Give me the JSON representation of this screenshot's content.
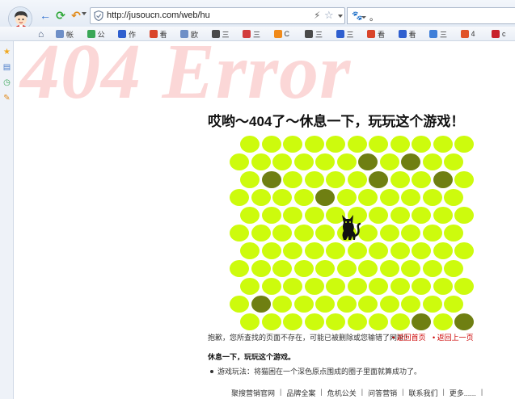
{
  "browser": {
    "url": "http://jusoucn.com/web/hu",
    "search_text": "。",
    "favorites": [
      {
        "label": "帐",
        "icon": "page-icon",
        "color": "#6e8fc7"
      },
      {
        "label": "公",
        "icon": "chrome-icon",
        "color": "#3aa757"
      },
      {
        "label": "作",
        "icon": "baidu-paw-icon",
        "color": "#2f5fcf"
      },
      {
        "label": "看",
        "icon": "chrome-icon",
        "color": "#d9442a"
      },
      {
        "label": "欧",
        "icon": "page-icon",
        "color": "#6e8fc7"
      },
      {
        "label": "三",
        "icon": "link-icon",
        "color": "#4a4a4a"
      },
      {
        "label": "三",
        "icon": "red-icon",
        "color": "#d23c3c"
      },
      {
        "label": "C",
        "icon": "orange-icon",
        "color": "#f08a1a"
      },
      {
        "label": "三",
        "icon": "link-icon",
        "color": "#4a4a4a"
      },
      {
        "label": "三",
        "icon": "paw-icon",
        "color": "#2f5fcf"
      },
      {
        "label": "看",
        "icon": "chrome-icon",
        "color": "#d9442a"
      },
      {
        "label": "看",
        "icon": "baidu-paw-icon",
        "color": "#2f5fcf"
      },
      {
        "label": "三",
        "icon": "grid-icon",
        "color": "#3f7fd9"
      },
      {
        "label": "4",
        "icon": "red-circle-icon",
        "color": "#e0542a"
      },
      {
        "label": "c",
        "icon": "c-icon",
        "color": "#c8202a"
      }
    ]
  },
  "page": {
    "watermark": "404 Error",
    "heading": "哎哟～404了～休息一下，玩玩这个游戏！",
    "error_message": "抱歉，您所查找的页面不存在，可能已被删除或您输错了网址！",
    "link_home": "返回首页",
    "link_back": "返回上一页",
    "rest_heading": "休息一下，玩玩这个游戏。",
    "rules": "游戏玩法：将猫困在一个深色原点围成的圈子里面就算成功了。",
    "footer": [
      "聚搜营销官网",
      "品牌全案",
      "危机公关",
      "问答营销",
      "联系我们",
      "更多......"
    ]
  },
  "game": {
    "rows": 11,
    "cols": 11,
    "cell_color": "#cdfb0d",
    "blocked_color": "#6f7f12",
    "blocked_cells": [
      [
        1,
        6
      ],
      [
        1,
        8
      ],
      [
        2,
        1
      ],
      [
        2,
        6
      ],
      [
        2,
        9
      ],
      [
        3,
        4
      ],
      [
        10,
        8
      ],
      [
        10,
        10
      ],
      [
        9,
        1
      ]
    ],
    "cat_cell": [
      5,
      5
    ]
  }
}
